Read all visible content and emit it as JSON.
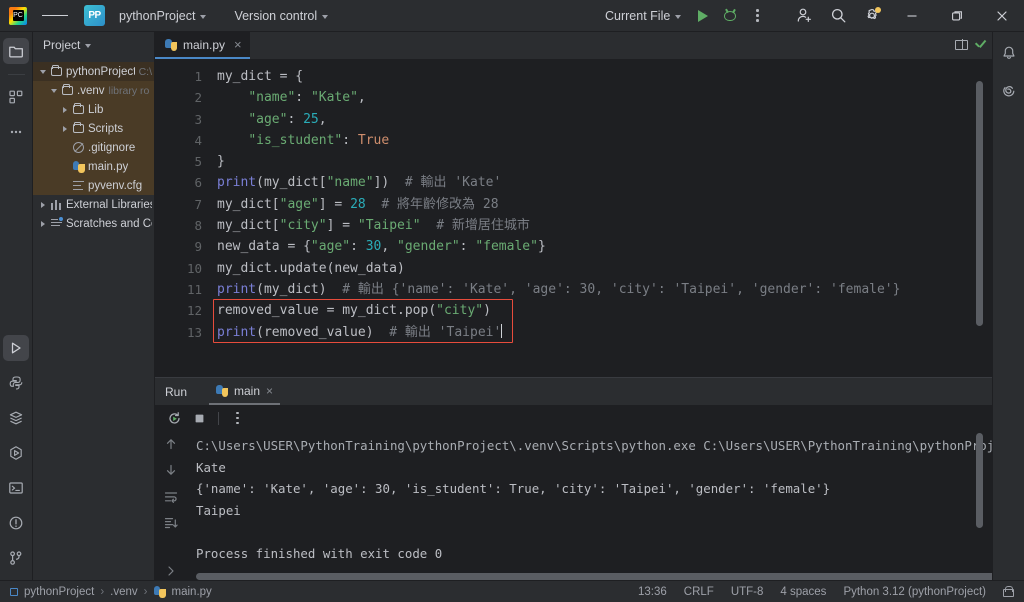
{
  "titlebar": {
    "menu_icon": "hamburger-menu-icon",
    "project_badge": "PP",
    "project_name": "pythonProject",
    "version_control": "Version control",
    "run_config": "Current File",
    "run_icon": "run-icon",
    "debug_icon": "debug-icon",
    "more_icon": "more-actions-icon",
    "account_icon": "add-account-icon",
    "search_icon": "search-icon",
    "settings_icon": "settings-gear-icon",
    "minimize": "minimize-icon",
    "maximize": "maximize-icon",
    "close": "close-icon"
  },
  "left_strip": {
    "items": [
      {
        "name": "project-tool-icon",
        "active": true
      },
      {
        "name": "structure-tool-icon",
        "active": false
      },
      {
        "name": "more-tool-windows-icon",
        "active": false
      }
    ],
    "bottom_items": [
      {
        "name": "run-tool-icon",
        "active": true
      },
      {
        "name": "python-console-icon",
        "active": false
      },
      {
        "name": "services-icon",
        "active": false
      },
      {
        "name": "run-coverage-icon",
        "active": false
      },
      {
        "name": "terminal-icon",
        "active": false
      },
      {
        "name": "problems-icon",
        "active": false
      },
      {
        "name": "version-control-icon",
        "active": false
      }
    ]
  },
  "right_strip": {
    "items": [
      {
        "name": "notifications-bell-icon"
      },
      {
        "name": "ai-assistant-icon"
      }
    ]
  },
  "project_panel": {
    "title": "Project",
    "tree": [
      {
        "label": "pythonProject",
        "suffix": "C:\\",
        "depth": 0,
        "icon": "folder-icon",
        "arrow": "expanded",
        "selected": true
      },
      {
        "label": ".venv",
        "suffix": "library ro",
        "depth": 1,
        "icon": "folder-icon",
        "arrow": "expanded",
        "highlight": true
      },
      {
        "label": "Lib",
        "suffix": "",
        "depth": 2,
        "icon": "folder-icon",
        "arrow": "collapsed",
        "highlight": true
      },
      {
        "label": "Scripts",
        "suffix": "",
        "depth": 2,
        "icon": "folder-icon",
        "arrow": "collapsed",
        "highlight": true
      },
      {
        "label": ".gitignore",
        "suffix": "",
        "depth": 2,
        "icon": "gitignore-icon",
        "arrow": "none",
        "highlight": true
      },
      {
        "label": "main.py",
        "suffix": "",
        "depth": 2,
        "icon": "python-file-icon",
        "arrow": "none",
        "highlight": true
      },
      {
        "label": "pyvenv.cfg",
        "suffix": "",
        "depth": 2,
        "icon": "config-file-icon",
        "arrow": "none",
        "highlight": true
      },
      {
        "label": "External Libraries",
        "suffix": "",
        "depth": 0,
        "icon": "library-icon",
        "arrow": "collapsed"
      },
      {
        "label": "Scratches and Con",
        "suffix": "",
        "depth": 0,
        "icon": "scratches-icon",
        "arrow": "collapsed"
      }
    ]
  },
  "editor": {
    "tab": {
      "label": "main.py",
      "icon": "python-file-icon",
      "close": "×"
    },
    "reader_mode_icon": "reader-mode-book-icon",
    "inspections_icon": "inspections-ok-checkmark-icon",
    "line_numbers": [
      "1",
      "2",
      "3",
      "4",
      "5",
      "6",
      "7",
      "8",
      "9",
      "10",
      "11",
      "12",
      "13"
    ],
    "highlight_color": "#e74c3c",
    "lines": [
      {
        "n": 1,
        "segments": [
          {
            "t": "my_dict ",
            "c": "pun"
          },
          {
            "t": "= ",
            "c": "pun"
          },
          {
            "t": "{",
            "c": "pun"
          }
        ]
      },
      {
        "n": 2,
        "segments": [
          {
            "t": "    ",
            "c": "pun"
          },
          {
            "t": "\"name\"",
            "c": "str"
          },
          {
            "t": ": ",
            "c": "pun"
          },
          {
            "t": "\"Kate\"",
            "c": "str"
          },
          {
            "t": ",",
            "c": "pun"
          }
        ]
      },
      {
        "n": 3,
        "segments": [
          {
            "t": "    ",
            "c": "pun"
          },
          {
            "t": "\"age\"",
            "c": "str"
          },
          {
            "t": ": ",
            "c": "pun"
          },
          {
            "t": "25",
            "c": "num"
          },
          {
            "t": ",",
            "c": "pun"
          }
        ]
      },
      {
        "n": 4,
        "segments": [
          {
            "t": "    ",
            "c": "pun"
          },
          {
            "t": "\"is_student\"",
            "c": "str"
          },
          {
            "t": ": ",
            "c": "pun"
          },
          {
            "t": "True",
            "c": "bi"
          }
        ]
      },
      {
        "n": 5,
        "segments": [
          {
            "t": "}",
            "c": "pun"
          }
        ]
      },
      {
        "n": 6,
        "segments": [
          {
            "t": "print",
            "c": "fn"
          },
          {
            "t": "(my_dict[",
            "c": "pun"
          },
          {
            "t": "\"name\"",
            "c": "str"
          },
          {
            "t": "])  ",
            "c": "pun"
          },
          {
            "t": "# 輸出 'Kate'",
            "c": "cmt"
          }
        ]
      },
      {
        "n": 7,
        "segments": [
          {
            "t": "my_dict[",
            "c": "pun"
          },
          {
            "t": "\"age\"",
            "c": "str"
          },
          {
            "t": "] = ",
            "c": "pun"
          },
          {
            "t": "28",
            "c": "num"
          },
          {
            "t": "  ",
            "c": "pun"
          },
          {
            "t": "# 將年齡修改為 28",
            "c": "cmt"
          }
        ]
      },
      {
        "n": 8,
        "segments": [
          {
            "t": "my_dict[",
            "c": "pun"
          },
          {
            "t": "\"city\"",
            "c": "str"
          },
          {
            "t": "] = ",
            "c": "pun"
          },
          {
            "t": "\"Taipei\"",
            "c": "str"
          },
          {
            "t": "  ",
            "c": "pun"
          },
          {
            "t": "# 新增居住城市",
            "c": "cmt"
          }
        ]
      },
      {
        "n": 9,
        "segments": [
          {
            "t": "new_data = {",
            "c": "pun"
          },
          {
            "t": "\"age\"",
            "c": "str"
          },
          {
            "t": ": ",
            "c": "pun"
          },
          {
            "t": "30",
            "c": "num"
          },
          {
            "t": ", ",
            "c": "pun"
          },
          {
            "t": "\"gender\"",
            "c": "str"
          },
          {
            "t": ": ",
            "c": "pun"
          },
          {
            "t": "\"female\"",
            "c": "str"
          },
          {
            "t": "}",
            "c": "pun"
          }
        ]
      },
      {
        "n": 10,
        "segments": [
          {
            "t": "my_dict.update(new_data)",
            "c": "pun"
          }
        ]
      },
      {
        "n": 11,
        "segments": [
          {
            "t": "print",
            "c": "fn"
          },
          {
            "t": "(my_dict)  ",
            "c": "pun"
          },
          {
            "t": "# 輸出 {'name': 'Kate', 'age': 30, 'city': 'Taipei', 'gender': 'female'}",
            "c": "cmt"
          }
        ]
      },
      {
        "n": 12,
        "segments": [
          {
            "t": "removed_value = my_dict.pop(",
            "c": "pun"
          },
          {
            "t": "\"city\"",
            "c": "str"
          },
          {
            "t": ")",
            "c": "pun"
          }
        ]
      },
      {
        "n": 13,
        "segments": [
          {
            "t": "print",
            "c": "fn"
          },
          {
            "t": "(removed_value)  ",
            "c": "pun"
          },
          {
            "t": "# 輸出 'Taipei'",
            "c": "cmt"
          }
        ]
      }
    ]
  },
  "run_panel": {
    "title": "Run",
    "tab": {
      "label": "main",
      "icon": "python-file-icon",
      "close": "×"
    },
    "toolbar": [
      {
        "name": "rerun-icon"
      },
      {
        "name": "stop-icon"
      },
      {
        "name": "more-actions-icon"
      }
    ],
    "gutter": [
      {
        "name": "previous-occurrence-icon"
      },
      {
        "name": "next-occurrence-icon"
      },
      {
        "name": "soft-wrap-icon"
      },
      {
        "name": "scroll-to-end-icon"
      },
      {
        "name": "expand-icon"
      }
    ],
    "console": [
      "C:\\Users\\USER\\PythonTraining\\pythonProject\\.venv\\Scripts\\python.exe C:\\Users\\USER\\PythonTraining\\pythonProject\\.venv\\main",
      "Kate",
      "{'name': 'Kate', 'age': 30, 'is_student': True, 'city': 'Taipei', 'gender': 'female'}",
      "Taipei",
      "",
      "Process finished with exit code 0"
    ]
  },
  "statusbar": {
    "breadcrumb": [
      "pythonProject",
      ".venv",
      "main.py"
    ],
    "separator": "›",
    "position": "13:36",
    "line_separator": "CRLF",
    "encoding": "UTF-8",
    "indent": "4 spaces",
    "interpreter": "Python 3.12 (pythonProject)",
    "lock_icon": "read-only-lock-icon"
  }
}
